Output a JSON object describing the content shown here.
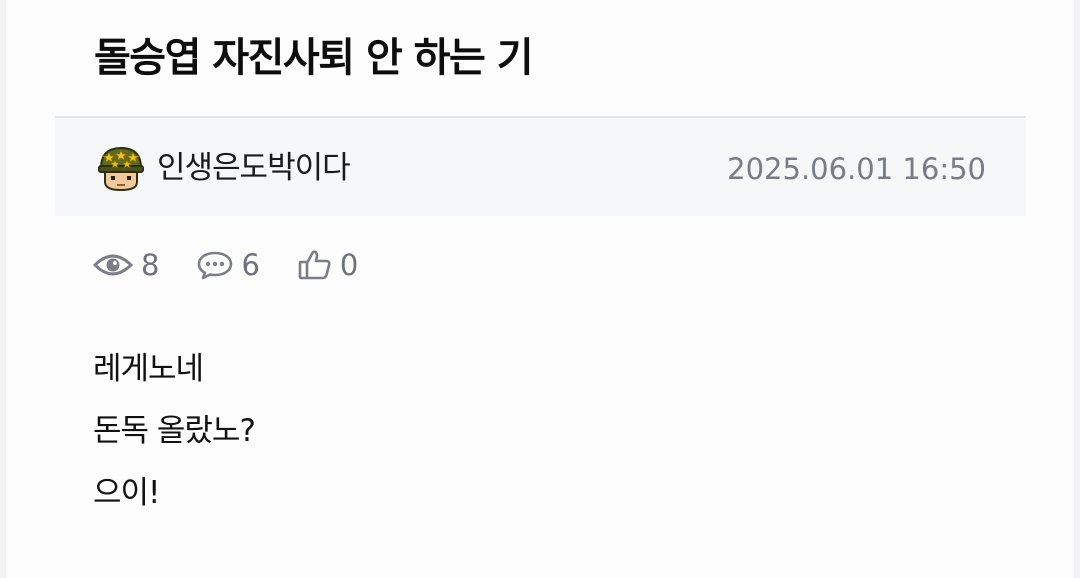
{
  "post": {
    "title": "돌승엽 자진사퇴 안 하는 기",
    "author": "인생은도박이다",
    "datetime": "2025.06.01 16:50",
    "stats": {
      "views": "8",
      "comments": "6",
      "likes": "0"
    },
    "body_lines": [
      "레게노네",
      "돈독 올랐노?",
      "으이!"
    ]
  },
  "icons": {
    "avatar": "soldier-helmet-avatar-icon",
    "views": "eye-icon",
    "comments": "speech-bubble-icon",
    "likes": "thumbs-up-icon"
  },
  "colors": {
    "meta_bar_bg": "#f6f7f9",
    "muted_text": "#787c84",
    "title_text": "#0d0d0d"
  }
}
